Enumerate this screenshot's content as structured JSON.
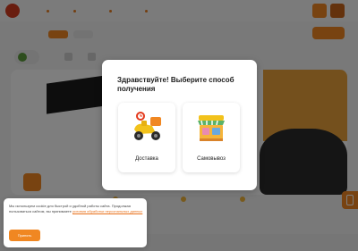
{
  "modal": {
    "title": "Здравствуйте! Выберите способ получения",
    "options": [
      {
        "label": "Доставка",
        "icon": "scooter-delivery-icon"
      },
      {
        "label": "Самовывоз",
        "icon": "shop-stall-icon"
      }
    ]
  },
  "cookie_banner": {
    "text": "Мы используем cookie для быстрой и удобной работы сайта. Продолжая пользоваться сайтом, вы принимаете ",
    "link_text": "условия обработки персональных данных",
    "button_label": "Принять"
  },
  "colors": {
    "accent": "#f08722",
    "overlay": "rgba(0,0,0,0.5)",
    "banner_red": "#e43a1e"
  }
}
